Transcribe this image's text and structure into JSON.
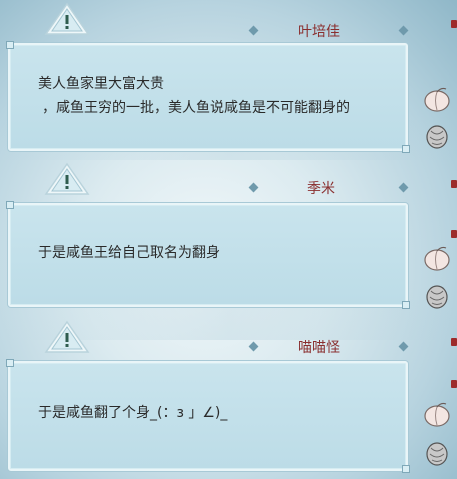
{
  "messages": [
    {
      "name": "叶培佳",
      "lines": [
        "美人鱼家里大富大贵",
        "，咸鱼王穷的一批，美人鱼说咸鱼是不可能翻身的"
      ]
    },
    {
      "name": "季米",
      "lines": [
        "于是咸鱼王给自己取名为翻身"
      ]
    },
    {
      "name": "喵喵怪",
      "lines": [
        "于是咸鱼翻了个身_(：з 」∠)_"
      ]
    }
  ],
  "icons": {
    "alert": "exclamation-triangle-icon",
    "fruit": "peach-icon",
    "mango": "mango-icon"
  },
  "colors": {
    "name_text": "#8a2f2f",
    "bubble": "#c9e4ed",
    "accent_dot": "#6f9aac"
  }
}
